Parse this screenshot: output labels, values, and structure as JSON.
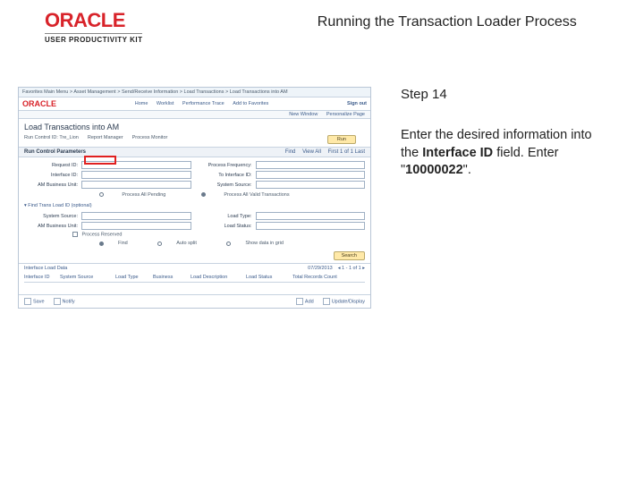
{
  "header": {
    "logo_text": "ORACLE",
    "logo_subtitle": "USER PRODUCTIVITY KIT",
    "title": "Running the Transaction Loader Process"
  },
  "instruction": {
    "step_label": "Step 14",
    "line1": "Enter the desired information into the ",
    "bold1": "Interface ID",
    "line2": " field. Enter \"",
    "bold2": "10000022",
    "line3": "\"."
  },
  "app": {
    "crumbs": "Favorites    Main Menu > Asset Management > Send/Receive Information > Load Transactions > Load Transactions into AM",
    "mini_logo": "ORACLE",
    "tabs": [
      "Home",
      "Worklist",
      "Performance Trace",
      "Add to Favorites"
    ],
    "signout": "Sign out",
    "subbar": [
      "New Window",
      "Personalize Page"
    ],
    "page_title": "Load Transactions into AM",
    "meta": {
      "run_control_label": "Run Control ID:",
      "run_control_value": "Tre_Lion",
      "report_mgr": "Report Manager",
      "process_mon": "Process Monitor",
      "run_btn": "Run"
    },
    "section1": "Run Control Parameters",
    "section1_right": [
      "Find",
      "View All",
      "First 1 of 1 Last"
    ],
    "fields_left": [
      {
        "label": "Request ID:"
      },
      {
        "label": "Interface ID:"
      },
      {
        "label": "AM Business Unit:"
      }
    ],
    "fields_right": [
      {
        "label": "Process Frequency:"
      },
      {
        "label": "To Interface ID:"
      },
      {
        "label": "System Source:"
      }
    ],
    "radio_a": "Process All Pending",
    "radio_b": "Process All Valid Transactions",
    "find_section": "Find Trans Load ID (optional)",
    "fields2_left": [
      {
        "label": "System Source:"
      },
      {
        "label": "AM Business Unit:"
      }
    ],
    "fields2_right": [
      {
        "label": "Load Type:"
      },
      {
        "label": "Load Status:"
      }
    ],
    "fin_check": "Process Reserved",
    "rradio_a": "Find",
    "rradio_b": "Auto split",
    "rradio_c": "Show data in grid",
    "search_btn": "Search",
    "results_label": "Interface Load Data",
    "results_date": "07/29/2013",
    "tbl_head": [
      "Interface ID",
      "System Source",
      "Load Type",
      "Business",
      "Load Description",
      "Load Status",
      "Total Records Count"
    ],
    "footer": {
      "save": "Save",
      "notify": "Notify",
      "add": "Add",
      "update": "Update/Display"
    }
  }
}
